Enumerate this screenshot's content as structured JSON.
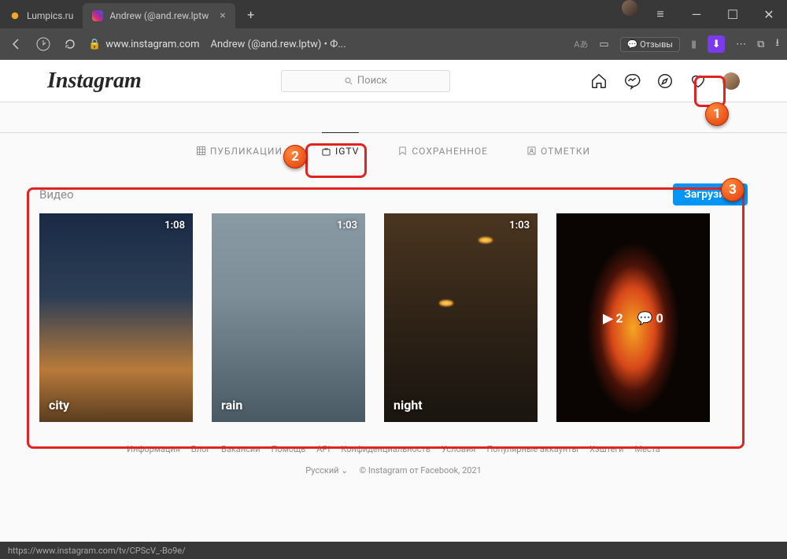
{
  "browser": {
    "tabs": [
      {
        "title": "Lumpics.ru",
        "active": false
      },
      {
        "title": "Andrew (@and.rew.lptw",
        "active": true
      }
    ],
    "url_domain": "www.instagram.com",
    "url_title": "Andrew (@and.rew.lptw) • Ф...",
    "reviews_label": "Отзывы",
    "status_url": "https://www.instagram.com/tv/CPScV_-Bo9e/"
  },
  "ig": {
    "logo": "Instagram",
    "search_placeholder": "Поиск",
    "tabs": {
      "posts": "ПУБЛИКАЦИИ",
      "igtv": "IGTV",
      "saved": "СОХРАНЕННОЕ",
      "tagged": "ОТМЕТКИ"
    },
    "section_title": "Видео",
    "upload_label": "Загрузить",
    "videos": [
      {
        "title": "city",
        "duration": "1:08"
      },
      {
        "title": "rain",
        "duration": "1:03"
      },
      {
        "title": "night",
        "duration": "1:03"
      },
      {
        "title": "",
        "duration": "",
        "plays": "2",
        "comments": "0"
      }
    ],
    "footer": {
      "links": [
        "Информация",
        "Блог",
        "Вакансии",
        "Помощь",
        "API",
        "Конфиденциальность",
        "Условия",
        "Популярные аккаунты",
        "Хэштеги",
        "Места"
      ],
      "language": "Русский",
      "copyright": "© Instagram от Facebook, 2021"
    }
  },
  "annotations": {
    "n1": "1",
    "n2": "2",
    "n3": "3"
  }
}
